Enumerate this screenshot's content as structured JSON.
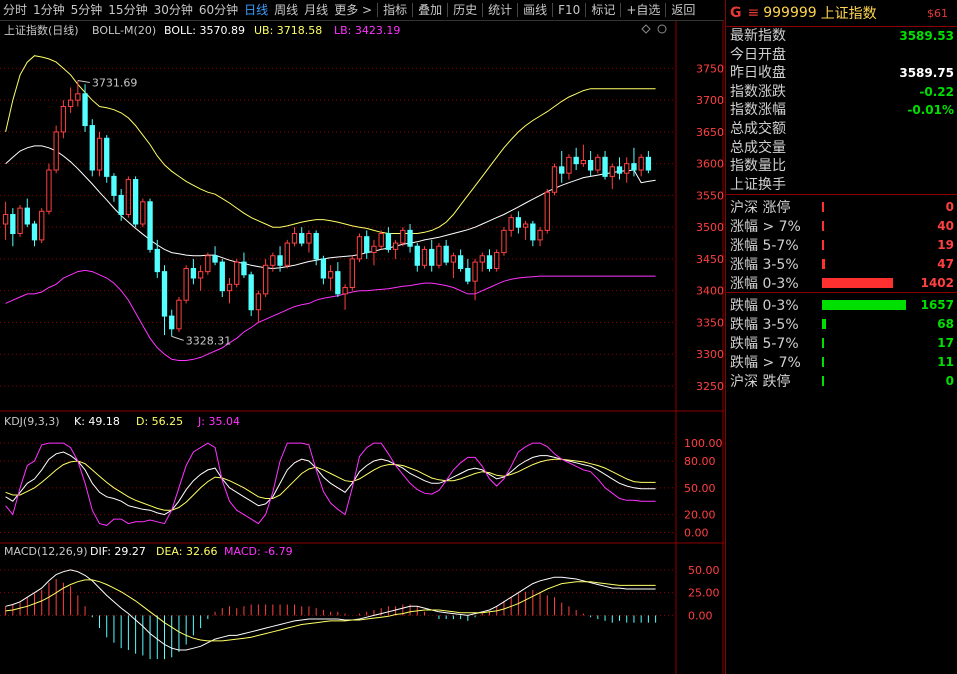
{
  "toolbar": {
    "tabs": [
      {
        "label": "分时"
      },
      {
        "label": "1分钟"
      },
      {
        "label": "5分钟"
      },
      {
        "label": "15分钟"
      },
      {
        "label": "30分钟"
      },
      {
        "label": "60分钟"
      },
      {
        "label": "日线",
        "active": true
      },
      {
        "label": "周线"
      },
      {
        "label": "月线"
      },
      {
        "label": "更多 >"
      }
    ],
    "tools": [
      {
        "label": "指标"
      },
      {
        "label": "叠加"
      },
      {
        "label": "历史"
      },
      {
        "label": "统计"
      },
      {
        "label": "画线"
      },
      {
        "label": "F10"
      },
      {
        "label": "标记"
      },
      {
        "label": "+自选"
      },
      {
        "label": "返回"
      }
    ]
  },
  "main_panel": {
    "title": "上证指数(日线)",
    "boll_label": "BOLL-M(20)",
    "boll_value": "BOLL: 3570.89",
    "ub_value": "UB: 3718.58",
    "lb_value": "LB: 3423.19",
    "high_marker": "3731.69",
    "low_marker": "3328.31",
    "y_ticks": [
      "3750",
      "3700",
      "3650",
      "3600",
      "3550",
      "3500",
      "3450",
      "3400",
      "3350",
      "3300",
      "3250"
    ]
  },
  "kdj_panel": {
    "title": "KDJ(9,3,3)",
    "k_value": "K: 49.18",
    "d_value": "D: 56.25",
    "j_value": "J: 35.04",
    "y_ticks": [
      "100.00",
      "80.00",
      "50.00",
      "20.00",
      "0.00"
    ]
  },
  "macd_panel": {
    "title": "MACD(12,26,9)",
    "dif_value": "DIF: 29.27",
    "dea_value": "DEA: 32.66",
    "macd_value": "MACD: -6.79",
    "y_ticks": [
      "50.00",
      "25.00",
      "0.00"
    ]
  },
  "quote": {
    "g_label": "G",
    "eq_label": "≡",
    "code": "999999",
    "name": "上证指数",
    "tag": "$61",
    "rows": [
      {
        "label": "最新指数",
        "value": "3589.53",
        "color": "green"
      },
      {
        "label": "今日开盘",
        "value": "",
        "color": "white"
      },
      {
        "label": "昨日收盘",
        "value": "3589.75",
        "color": "white"
      },
      {
        "label": "指数涨跌",
        "value": "-0.22",
        "color": "green"
      },
      {
        "label": "指数涨幅",
        "value": "-0.01%",
        "color": "green"
      },
      {
        "label": "总成交额",
        "value": "",
        "color": "white"
      },
      {
        "label": "总成交量",
        "value": "",
        "color": "white"
      },
      {
        "label": "指数量比",
        "value": "",
        "color": "white"
      },
      {
        "label": "上证换手",
        "value": "",
        "color": "white"
      }
    ],
    "up_stats": [
      {
        "label": "沪深 涨停",
        "value": "0",
        "bar": 0.01
      },
      {
        "label": "涨幅 > 7%",
        "value": "40",
        "bar": 0.01
      },
      {
        "label": "涨幅 5-7%",
        "value": "19",
        "bar": 0.01
      },
      {
        "label": "涨幅 3-5%",
        "value": "47",
        "bar": 0.03
      },
      {
        "label": "涨幅 0-3%",
        "value": "1402",
        "bar": 0.85
      }
    ],
    "down_stats": [
      {
        "label": "跌幅 0-3%",
        "value": "1657",
        "bar": 1.0
      },
      {
        "label": "跌幅 3-5%",
        "value": "68",
        "bar": 0.05
      },
      {
        "label": "跌幅 5-7%",
        "value": "17",
        "bar": 0.01
      },
      {
        "label": "跌幅 > 7%",
        "value": "11",
        "bar": 0.01
      },
      {
        "label": "沪深 跌停",
        "value": "0",
        "bar": 0.01
      }
    ]
  },
  "colors": {
    "up": "#ff4040",
    "down": "#54ffff",
    "boll_mid": "#ffffff",
    "boll_ub": "#ffff66",
    "boll_lb": "#ff33ff",
    "k": "#ffffff",
    "d": "#ffff66",
    "j": "#ff33ff",
    "grid": "#8b0000"
  },
  "chart_data": {
    "type": "candlestick",
    "candles": [
      [
        3505,
        3540,
        3480,
        3520
      ],
      [
        3520,
        3530,
        3470,
        3490
      ],
      [
        3490,
        3535,
        3485,
        3530
      ],
      [
        3530,
        3545,
        3500,
        3505
      ],
      [
        3505,
        3510,
        3470,
        3480
      ],
      [
        3480,
        3530,
        3475,
        3525
      ],
      [
        3525,
        3600,
        3520,
        3590
      ],
      [
        3590,
        3660,
        3585,
        3650
      ],
      [
        3650,
        3700,
        3640,
        3690
      ],
      [
        3690,
        3720,
        3680,
        3700
      ],
      [
        3700,
        3731,
        3690,
        3710
      ],
      [
        3710,
        3725,
        3650,
        3660
      ],
      [
        3660,
        3670,
        3580,
        3590
      ],
      [
        3590,
        3650,
        3580,
        3640
      ],
      [
        3640,
        3645,
        3570,
        3580
      ],
      [
        3580,
        3585,
        3540,
        3550
      ],
      [
        3550,
        3560,
        3510,
        3520
      ],
      [
        3520,
        3580,
        3515,
        3575
      ],
      [
        3575,
        3580,
        3500,
        3505
      ],
      [
        3505,
        3545,
        3500,
        3540
      ],
      [
        3540,
        3545,
        3460,
        3465
      ],
      [
        3465,
        3480,
        3420,
        3430
      ],
      [
        3430,
        3440,
        3330,
        3360
      ],
      [
        3360,
        3370,
        3328,
        3340
      ],
      [
        3340,
        3390,
        3335,
        3385
      ],
      [
        3385,
        3440,
        3380,
        3435
      ],
      [
        3435,
        3450,
        3410,
        3420
      ],
      [
        3420,
        3440,
        3400,
        3430
      ],
      [
        3430,
        3460,
        3425,
        3455
      ],
      [
        3455,
        3470,
        3440,
        3445
      ],
      [
        3445,
        3450,
        3390,
        3400
      ],
      [
        3400,
        3420,
        3380,
        3410
      ],
      [
        3410,
        3450,
        3405,
        3445
      ],
      [
        3445,
        3460,
        3420,
        3425
      ],
      [
        3425,
        3430,
        3360,
        3370
      ],
      [
        3370,
        3400,
        3350,
        3395
      ],
      [
        3395,
        3450,
        3390,
        3440
      ],
      [
        3440,
        3460,
        3430,
        3455
      ],
      [
        3455,
        3470,
        3430,
        3440
      ],
      [
        3440,
        3480,
        3435,
        3475
      ],
      [
        3475,
        3500,
        3470,
        3490
      ],
      [
        3490,
        3500,
        3470,
        3475
      ],
      [
        3475,
        3495,
        3460,
        3490
      ],
      [
        3490,
        3495,
        3440,
        3450
      ],
      [
        3450,
        3455,
        3410,
        3420
      ],
      [
        3420,
        3440,
        3400,
        3430
      ],
      [
        3430,
        3445,
        3390,
        3395
      ],
      [
        3395,
        3410,
        3370,
        3405
      ],
      [
        3405,
        3455,
        3400,
        3450
      ],
      [
        3450,
        3490,
        3445,
        3485
      ],
      [
        3485,
        3495,
        3450,
        3460
      ],
      [
        3460,
        3480,
        3440,
        3470
      ],
      [
        3470,
        3495,
        3465,
        3490
      ],
      [
        3490,
        3500,
        3460,
        3465
      ],
      [
        3465,
        3480,
        3450,
        3475
      ],
      [
        3475,
        3500,
        3470,
        3495
      ],
      [
        3495,
        3505,
        3460,
        3470
      ],
      [
        3470,
        3475,
        3430,
        3440
      ],
      [
        3440,
        3470,
        3435,
        3465
      ],
      [
        3465,
        3480,
        3430,
        3440
      ],
      [
        3440,
        3475,
        3435,
        3470
      ],
      [
        3470,
        3480,
        3440,
        3445
      ],
      [
        3445,
        3460,
        3420,
        3455
      ],
      [
        3455,
        3465,
        3430,
        3435
      ],
      [
        3435,
        3450,
        3410,
        3415
      ],
      [
        3415,
        3450,
        3385,
        3445
      ],
      [
        3445,
        3460,
        3430,
        3455
      ],
      [
        3455,
        3465,
        3430,
        3435
      ],
      [
        3435,
        3465,
        3430,
        3460
      ],
      [
        3460,
        3500,
        3455,
        3495
      ],
      [
        3495,
        3520,
        3485,
        3515
      ],
      [
        3515,
        3525,
        3490,
        3500
      ],
      [
        3500,
        3510,
        3480,
        3505
      ],
      [
        3505,
        3510,
        3470,
        3480
      ],
      [
        3480,
        3500,
        3470,
        3495
      ],
      [
        3495,
        3560,
        3490,
        3555
      ],
      [
        3555,
        3600,
        3550,
        3595
      ],
      [
        3595,
        3620,
        3570,
        3585
      ],
      [
        3585,
        3615,
        3575,
        3610
      ],
      [
        3610,
        3625,
        3590,
        3600
      ],
      [
        3600,
        3630,
        3595,
        3605
      ],
      [
        3605,
        3620,
        3580,
        3590
      ],
      [
        3590,
        3615,
        3585,
        3610
      ],
      [
        3610,
        3620,
        3575,
        3580
      ],
      [
        3580,
        3600,
        3560,
        3595
      ],
      [
        3595,
        3610,
        3575,
        3585
      ],
      [
        3585,
        3610,
        3570,
        3600
      ],
      [
        3600,
        3625,
        3580,
        3590
      ],
      [
        3590,
        3615,
        3580,
        3610
      ],
      [
        3610,
        3620,
        3585,
        3590
      ]
    ],
    "boll_mid": [
      3600,
      3610,
      3620,
      3625,
      3628,
      3628,
      3625,
      3620,
      3612,
      3603,
      3592,
      3580,
      3568,
      3555,
      3543,
      3530,
      3518,
      3508,
      3498,
      3489,
      3480,
      3472,
      3465,
      3460,
      3458,
      3456,
      3455,
      3455,
      3456,
      3456,
      3452,
      3448,
      3445,
      3443,
      3440,
      3438,
      3436,
      3435,
      3436,
      3438,
      3440,
      3443,
      3446,
      3448,
      3450,
      3452,
      3453,
      3454,
      3455,
      3457,
      3460,
      3462,
      3465,
      3467,
      3470,
      3473,
      3475,
      3477,
      3480,
      3482,
      3484,
      3487,
      3490,
      3493,
      3496,
      3500,
      3505,
      3510,
      3515,
      3520,
      3526,
      3532,
      3538,
      3544,
      3550,
      3556,
      3561,
      3566,
      3570,
      3574,
      3578,
      3580,
      3582,
      3584,
      3586,
      3588,
      3589,
      3590,
      3570,
      3572,
      3574
    ],
    "boll_ub": [
      3650,
      3700,
      3740,
      3760,
      3770,
      3768,
      3765,
      3760,
      3750,
      3740,
      3725,
      3712,
      3700,
      3690,
      3688,
      3685,
      3680,
      3672,
      3660,
      3645,
      3630,
      3612,
      3598,
      3588,
      3580,
      3572,
      3566,
      3560,
      3555,
      3552,
      3545,
      3538,
      3530,
      3522,
      3515,
      3510,
      3505,
      3500,
      3500,
      3502,
      3505,
      3508,
      3510,
      3512,
      3512,
      3510,
      3508,
      3505,
      3502,
      3500,
      3498,
      3495,
      3492,
      3490,
      3490,
      3490,
      3490,
      3490,
      3492,
      3495,
      3500,
      3508,
      3520,
      3535,
      3550,
      3565,
      3580,
      3595,
      3610,
      3625,
      3638,
      3650,
      3660,
      3668,
      3675,
      3682,
      3690,
      3698,
      3705,
      3710,
      3715,
      3718,
      3718,
      3718,
      3718,
      3718,
      3718,
      3718,
      3718,
      3718,
      3718
    ],
    "boll_lb": [
      3380,
      3385,
      3390,
      3395,
      3395,
      3398,
      3405,
      3410,
      3420,
      3425,
      3430,
      3432,
      3430,
      3425,
      3420,
      3412,
      3400,
      3385,
      3365,
      3345,
      3325,
      3310,
      3300,
      3292,
      3290,
      3290,
      3292,
      3295,
      3300,
      3305,
      3310,
      3318,
      3325,
      3335,
      3342,
      3350,
      3355,
      3360,
      3365,
      3370,
      3375,
      3378,
      3380,
      3385,
      3388,
      3390,
      3392,
      3395,
      3398,
      3400,
      3400,
      3401,
      3402,
      3403,
      3405,
      3407,
      3408,
      3410,
      3412,
      3412,
      3410,
      3408,
      3405,
      3400,
      3395,
      3395,
      3400,
      3405,
      3410,
      3415,
      3418,
      3420,
      3421,
      3422,
      3423,
      3423,
      3423,
      3423,
      3423,
      3423,
      3423,
      3423,
      3423,
      3423,
      3423,
      3423,
      3423,
      3423,
      3423,
      3423,
      3423
    ],
    "kdj_k": [
      40,
      35,
      45,
      55,
      60,
      70,
      82,
      88,
      90,
      86,
      80,
      70,
      55,
      45,
      40,
      38,
      35,
      30,
      28,
      26,
      25,
      22,
      20,
      25,
      35,
      48,
      58,
      65,
      70,
      72,
      60,
      50,
      45,
      40,
      35,
      30,
      32,
      40,
      55,
      70,
      78,
      82,
      80,
      72,
      62,
      55,
      50,
      45,
      55,
      68,
      75,
      80,
      82,
      80,
      76,
      72,
      66,
      62,
      58,
      55,
      55,
      58,
      62,
      66,
      70,
      72,
      70,
      65,
      60,
      62,
      68,
      75,
      80,
      84,
      86,
      86,
      84,
      82,
      80,
      78,
      76,
      74,
      70,
      65,
      60,
      55,
      52,
      50,
      49,
      49,
      49
    ],
    "kdj_d": [
      45,
      42,
      42,
      46,
      50,
      56,
      63,
      70,
      76,
      79,
      80,
      77,
      70,
      63,
      56,
      50,
      45,
      40,
      36,
      33,
      30,
      27,
      25,
      25,
      28,
      34,
      42,
      50,
      57,
      62,
      61,
      58,
      54,
      50,
      45,
      40,
      38,
      38,
      42,
      50,
      58,
      66,
      71,
      73,
      70,
      66,
      62,
      58,
      57,
      60,
      65,
      70,
      74,
      76,
      76,
      75,
      72,
      69,
      65,
      61,
      59,
      58,
      58,
      60,
      63,
      66,
      68,
      67,
      64,
      63,
      65,
      68,
      72,
      76,
      79,
      81,
      82,
      82,
      81,
      80,
      79,
      77,
      75,
      72,
      68,
      64,
      60,
      57,
      56,
      56,
      56
    ],
    "kdj_j": [
      30,
      20,
      50,
      75,
      80,
      98,
      100,
      100,
      100,
      95,
      80,
      55,
      25,
      10,
      8,
      15,
      15,
      10,
      12,
      12,
      14,
      12,
      10,
      25,
      50,
      75,
      90,
      95,
      100,
      95,
      58,
      35,
      25,
      20,
      15,
      10,
      20,
      45,
      80,
      100,
      100,
      100,
      98,
      70,
      46,
      33,
      26,
      20,
      50,
      85,
      95,
      100,
      100,
      88,
      75,
      65,
      55,
      48,
      44,
      43,
      47,
      58,
      70,
      78,
      84,
      84,
      74,
      60,
      52,
      60,
      74,
      90,
      96,
      100,
      100,
      96,
      88,
      82,
      78,
      74,
      70,
      68,
      60,
      50,
      44,
      38,
      36,
      36,
      35,
      35,
      35
    ],
    "macd_dif": [
      10,
      12,
      15,
      20,
      25,
      30,
      38,
      45,
      48,
      50,
      48,
      44,
      38,
      30,
      22,
      15,
      8,
      2,
      -5,
      -12,
      -20,
      -26,
      -32,
      -36,
      -38,
      -38,
      -36,
      -34,
      -30,
      -26,
      -24,
      -22,
      -22,
      -20,
      -18,
      -16,
      -14,
      -12,
      -10,
      -8,
      -6,
      -5,
      -4,
      -4,
      -4,
      -4,
      -4,
      -5,
      -5,
      -4,
      -2,
      0,
      2,
      4,
      6,
      8,
      10,
      10,
      8,
      6,
      4,
      3,
      2,
      1,
      0,
      2,
      4,
      6,
      10,
      15,
      20,
      25,
      30,
      35,
      38,
      40,
      42,
      42,
      41,
      40,
      38,
      36,
      34,
      32,
      30,
      30,
      29,
      29,
      29,
      29,
      29
    ],
    "macd_dea": [
      5,
      6,
      8,
      10,
      13,
      16,
      20,
      25,
      30,
      34,
      37,
      39,
      39,
      37,
      34,
      30,
      26,
      21,
      16,
      10,
      4,
      -2,
      -8,
      -13,
      -18,
      -22,
      -25,
      -27,
      -28,
      -28,
      -28,
      -27,
      -26,
      -25,
      -24,
      -22,
      -20,
      -18,
      -16,
      -14,
      -12,
      -10,
      -9,
      -8,
      -7,
      -6,
      -6,
      -6,
      -5,
      -5,
      -4,
      -3,
      -2,
      -1,
      1,
      2,
      4,
      5,
      6,
      6,
      6,
      5,
      4,
      3,
      3,
      3,
      3,
      4,
      5,
      7,
      10,
      13,
      17,
      21,
      25,
      29,
      32,
      35,
      36,
      37,
      37,
      37,
      36,
      35,
      34,
      33,
      33,
      33,
      33,
      33,
      33
    ]
  }
}
